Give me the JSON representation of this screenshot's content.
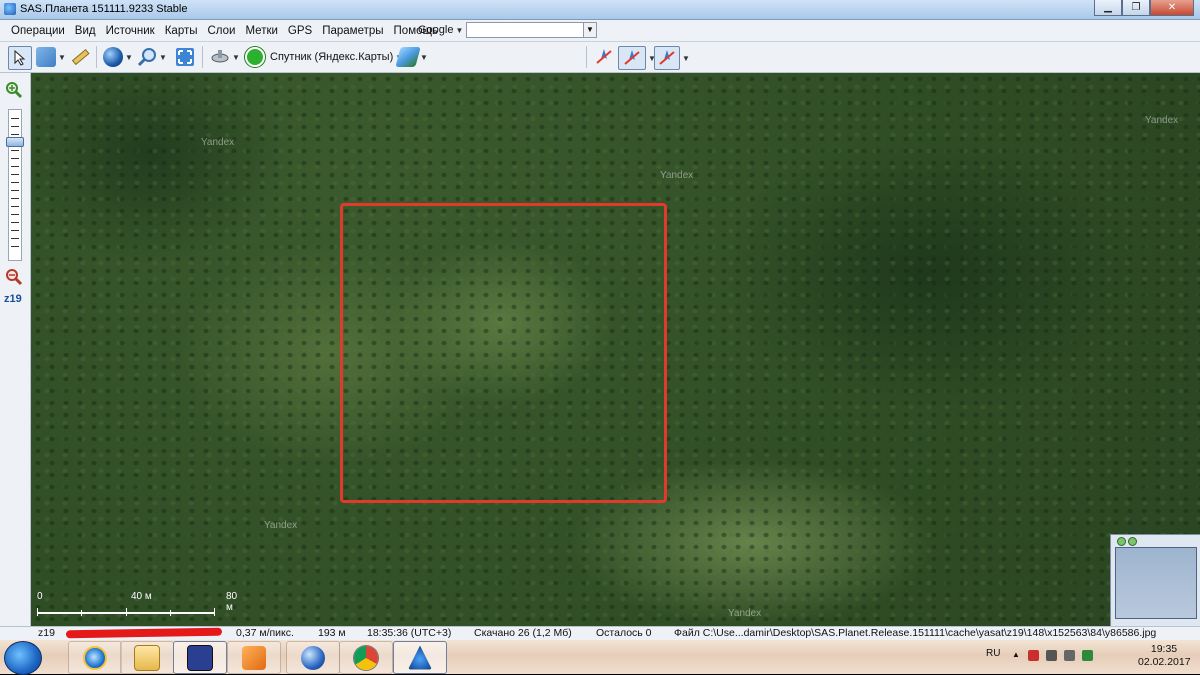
{
  "window": {
    "title": "SAS.Планета 151111.9233 Stable",
    "buttons": {
      "minimize": "▁",
      "maximize": "❐",
      "close": "✕"
    }
  },
  "menu": {
    "items": [
      "Операции",
      "Вид",
      "Источник",
      "Карты",
      "Слои",
      "Метки",
      "GPS",
      "Параметры",
      "Помощь"
    ],
    "geocoder": {
      "selected": "Google",
      "value": ""
    }
  },
  "toolbar": {
    "map_source_label": "Спутник (Яндекс.Карты)",
    "icons": [
      "cursor-icon",
      "layers-icon",
      "ruler-icon",
      "globe-icon",
      "magnifier-icon",
      "fullscreen-icon",
      "satellite-icon",
      "refresh-icon",
      "map-type-icon",
      "gps-icon-1",
      "gps-icon-2",
      "gps-icon-3"
    ]
  },
  "zoom": {
    "level_label": "z19",
    "level": 19
  },
  "map": {
    "watermarks": [
      "Yandex",
      "Yandex",
      "Yandex",
      "Yandex",
      "Yandex"
    ],
    "selection_color": "#e03a2c",
    "scale": {
      "zero": "0",
      "mid": "40 м",
      "end": "80 м"
    }
  },
  "status": {
    "zoom": "z19",
    "resolution": "0,37 м/пикс.",
    "altitude": "193 м",
    "time": "18:35:36 (UTC+3)",
    "downloaded": "Скачано 26 (1,2 Мб)",
    "remaining": "Осталось 0",
    "file": "Файл C:\\Use...damir\\Desktop\\SAS.Planet.Release.151111\\cache\\yasat\\z19\\148\\x152563\\84\\y86586.jpg"
  },
  "taskbar": {
    "apps": [
      "ie-icon",
      "explorer-icon",
      "save-icon",
      "media-player-icon",
      "google-earth-icon",
      "chrome-icon",
      "sas-planet-icon"
    ],
    "tray": {
      "lang": "RU",
      "time": "19:35",
      "date": "02.02.2017"
    }
  }
}
